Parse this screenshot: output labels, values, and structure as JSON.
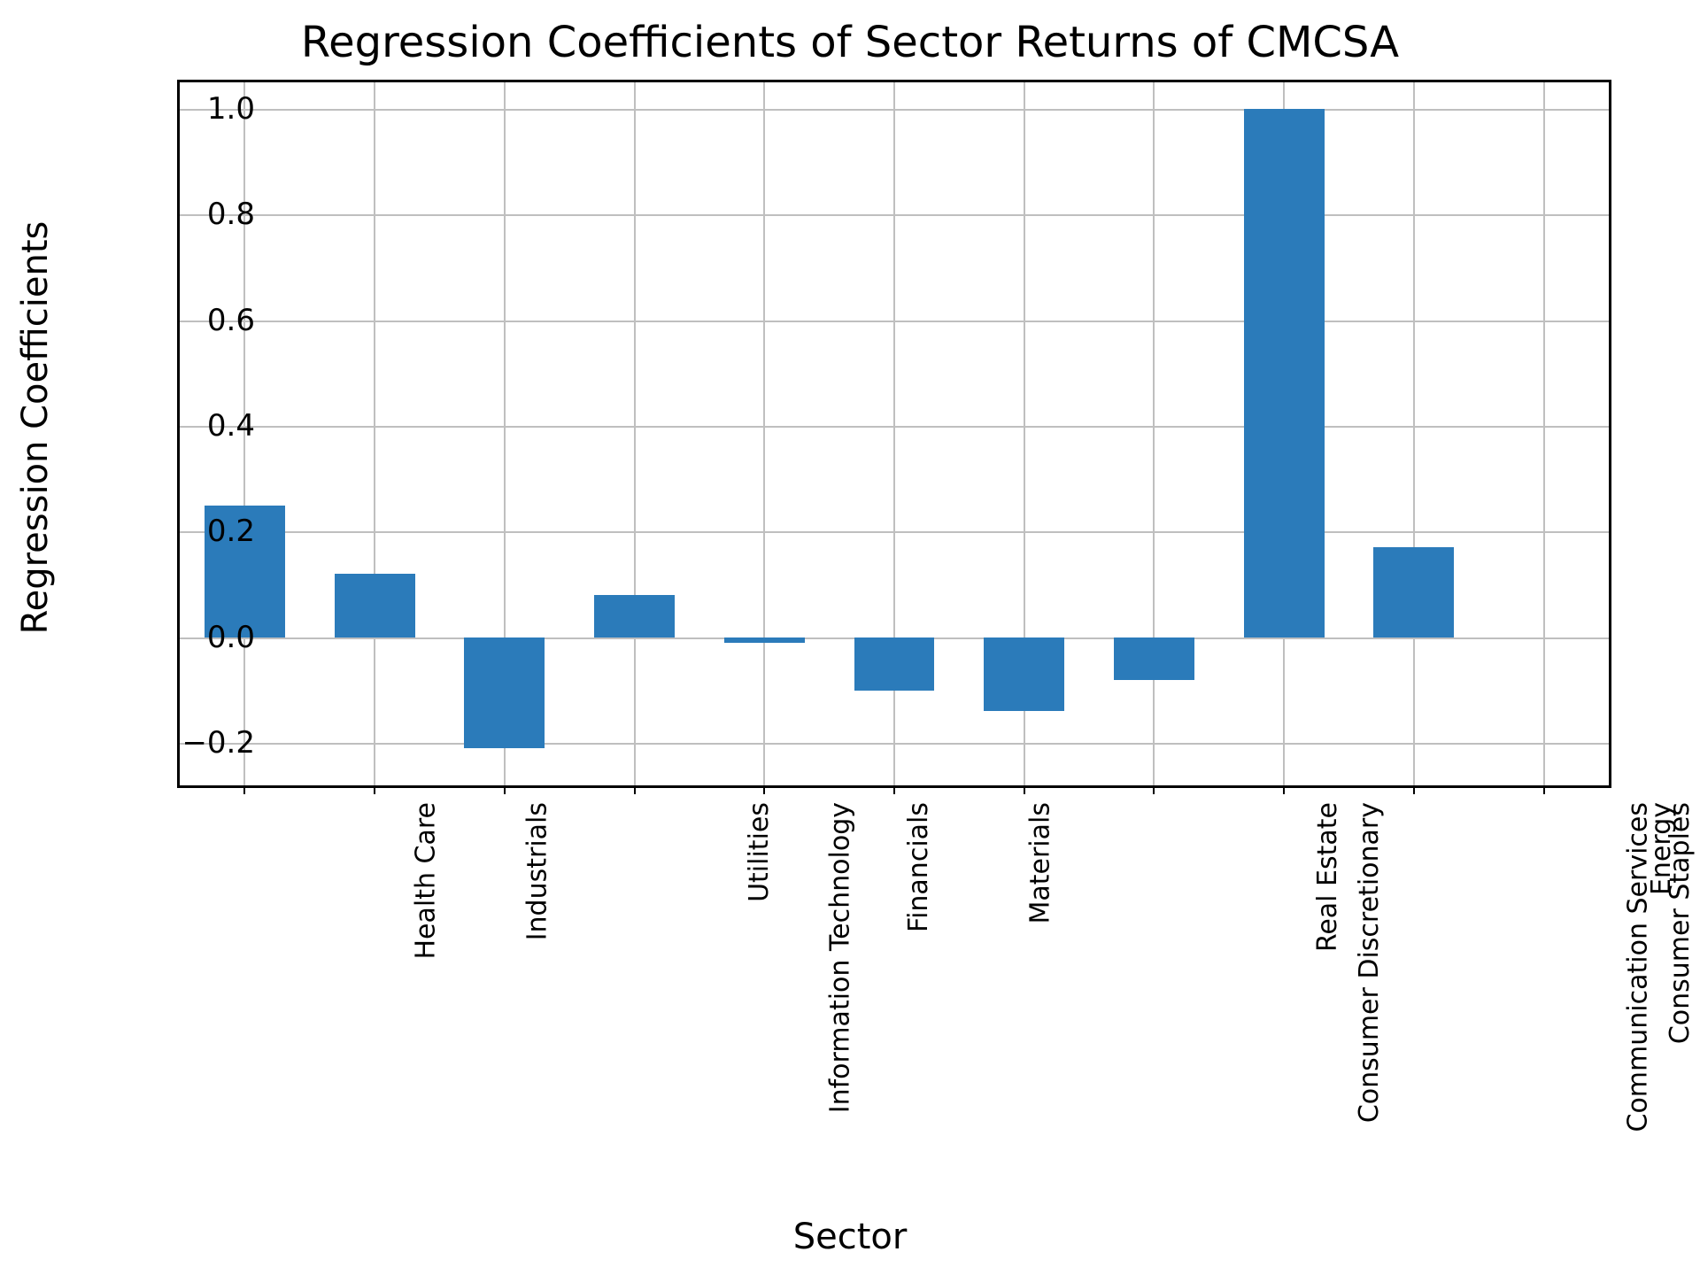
{
  "chart_data": {
    "type": "bar",
    "title": "Regression Coefficients of Sector Returns of CMCSA",
    "xlabel": "Sector",
    "ylabel": "Regression Coefficients",
    "ylim": [
      -0.28,
      1.05
    ],
    "yticks": [
      -0.2,
      0.0,
      0.2,
      0.4,
      0.6,
      0.8,
      1.0
    ],
    "ytick_labels": [
      "−0.2",
      "0.0",
      "0.2",
      "0.4",
      "0.6",
      "0.8",
      "1.0"
    ],
    "categories": [
      "Health Care",
      "Industrials",
      "Information Technology",
      "Utilities",
      "Financials",
      "Materials",
      "Consumer Discretionary",
      "Real Estate",
      "Communication Services",
      "Consumer Staples",
      "Energy"
    ],
    "values": [
      0.25,
      0.12,
      -0.21,
      0.08,
      -0.01,
      -0.1,
      -0.14,
      -0.08,
      1.0,
      0.17,
      0.0
    ],
    "bar_color": "#2b7bba"
  }
}
